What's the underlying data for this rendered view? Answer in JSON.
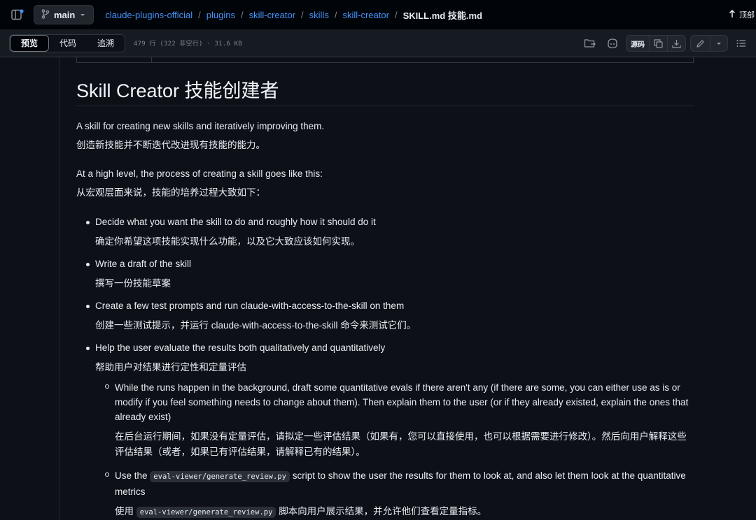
{
  "topbar": {
    "sidebar_toggle_icon": "sidebar-expand-icon",
    "branch": "main",
    "breadcrumb": [
      "claude-plugins-official",
      "plugins",
      "skill-creator",
      "skills",
      "skill-creator"
    ],
    "current_file": "SKILL.md  技能.md",
    "top_button": "顶部"
  },
  "toolbar": {
    "tabs": [
      "预览",
      "代码",
      "追溯"
    ],
    "active_tab": "预览",
    "file_info": "479 行 (322 非空行) · 31.6 KB",
    "raw_label": "源码"
  },
  "article": {
    "title": "Skill Creator  技能创建者",
    "intro_en": "A skill for creating new skills and iteratively improving them.",
    "intro_zh": "创造新技能并不断迭代改进现有技能的能力。",
    "process_en": "At a high level, the process of creating a skill goes like this:",
    "process_zh": "从宏观层面来说，技能的培养过程大致如下：",
    "steps": [
      {
        "en": "Decide what you want the skill to do and roughly how it should do it",
        "zh": "确定你希望这项技能实现什么功能，以及它大致应该如何实现。"
      },
      {
        "en": "Write a draft of the skill",
        "zh": "撰写一份技能草案"
      },
      {
        "en": "Create a few test prompts and run claude-with-access-to-the-skill on them",
        "zh": "创建一些测试提示，并运行 claude-with-access-to-the-skill 命令来测试它们。"
      },
      {
        "en": "Help the user evaluate the results both qualitatively and quantitatively",
        "zh": "帮助用户对结果进行定性和定量评估"
      }
    ],
    "substeps": [
      {
        "en": "While the runs happen in the background, draft some quantitative evals if there aren't any (if there are some, you can either use as is or modify if you feel something needs to change about them). Then explain them to the user (or if they already existed, explain the ones that already exist)",
        "zh": "在后台运行期间，如果没有定量评估，请拟定一些评估结果（如果有，您可以直接使用，也可以根据需要进行修改）。然后向用户解释这些评估结果（或者，如果已有评估结果，请解释已有的结果）。"
      },
      {
        "en_before": "Use the",
        "en_code": "eval-viewer/generate_review.py",
        "en_after": "script to show the user the results for them to look at, and also let them look at the quantitative metrics",
        "zh_before": "使用",
        "zh_code": "eval-viewer/generate_review.py",
        "zh_after": "脚本向用户展示结果，并允许他们查看定量指标。"
      }
    ]
  }
}
